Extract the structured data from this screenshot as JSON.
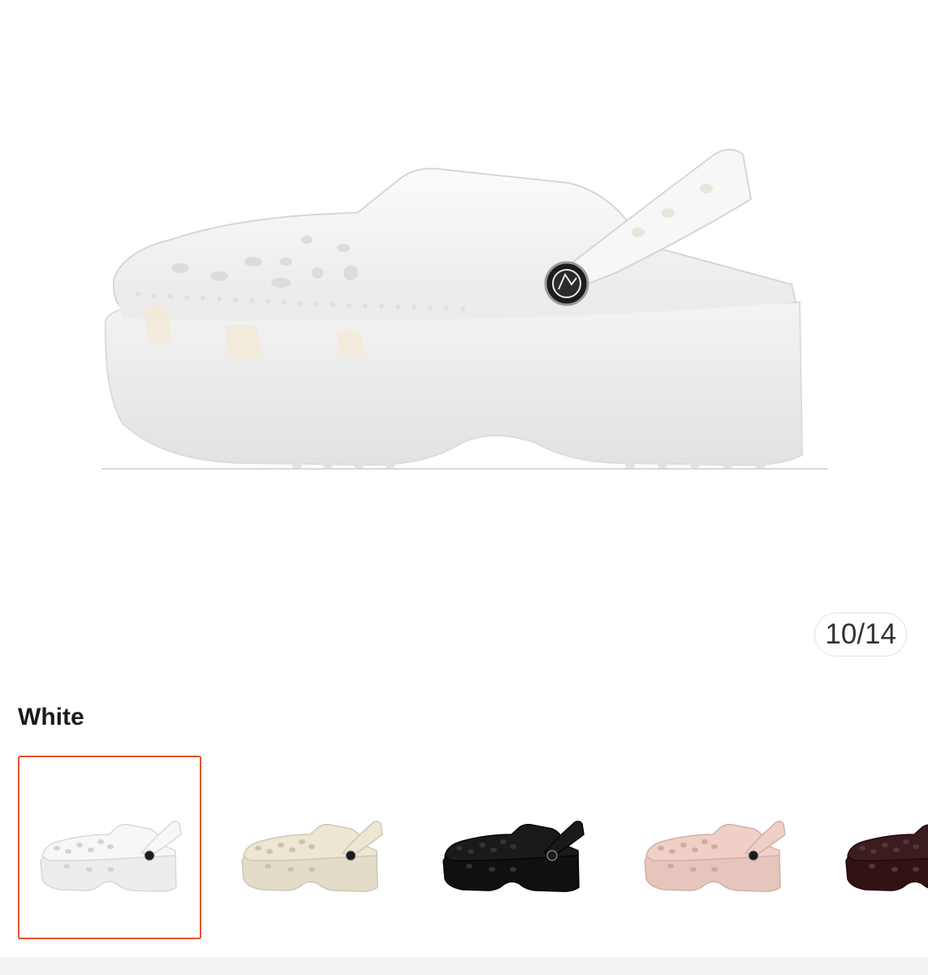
{
  "gallery": {
    "counter": "10/14",
    "main_image": "white-platform-clog-photo"
  },
  "variant": {
    "selected_name": "White",
    "options": [
      {
        "name": "White",
        "icon": "clog-thumbnail",
        "color": "#f7f7f5",
        "selected": true
      },
      {
        "name": "",
        "icon": "clog-thumbnail",
        "color": "#ece6d3",
        "selected": false
      },
      {
        "name": "",
        "icon": "clog-thumbnail",
        "color": "#1a1a1a",
        "selected": false
      },
      {
        "name": "",
        "icon": "clog-thumbnail",
        "color": "#efcfc6",
        "selected": false
      },
      {
        "name": "",
        "icon": "clog-thumbnail",
        "color": "#3b1d1f",
        "selected": false
      }
    ]
  },
  "colors": {
    "accent": "#e0562b"
  }
}
